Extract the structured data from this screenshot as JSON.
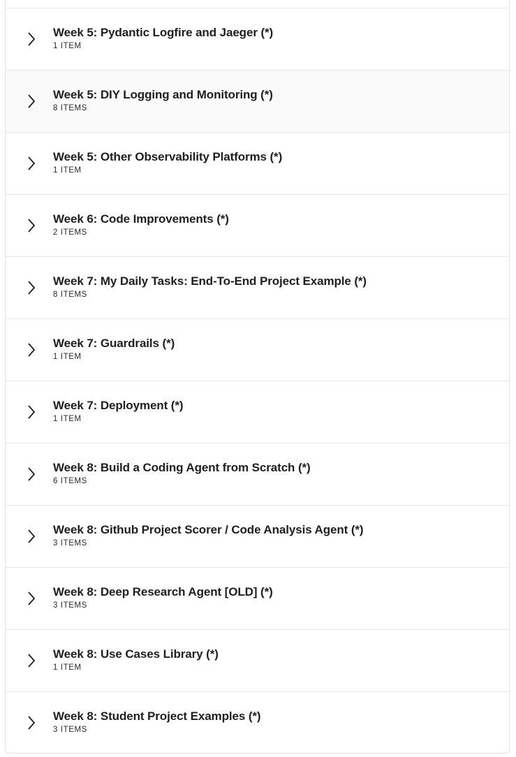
{
  "sections": [
    {
      "title": "Week 5: Pydantic Logfire and Jaeger (*)",
      "count": "1 ITEM",
      "icon": "chevron-right-icon"
    },
    {
      "title": "Week 5: DIY Logging and Monitoring (*)",
      "count": "8 ITEMS",
      "icon": "chevron-right-icon"
    },
    {
      "title": "Week 5: Other Observability Platforms (*)",
      "count": "1 ITEM",
      "icon": "chevron-right-icon"
    },
    {
      "title": "Week 6: Code Improvements (*)",
      "count": "2 ITEMS",
      "icon": "chevron-right-icon"
    },
    {
      "title": "Week 7: My Daily Tasks: End-To-End Project Example (*)",
      "count": "8 ITEMS",
      "icon": "chevron-right-icon"
    },
    {
      "title": "Week 7: Guardrails (*)",
      "count": "1 ITEM",
      "icon": "chevron-right-icon"
    },
    {
      "title": "Week 7: Deployment (*)",
      "count": "1 ITEM",
      "icon": "chevron-right-icon"
    },
    {
      "title": "Week 8: Build a Coding Agent from Scratch (*)",
      "count": "6 ITEMS",
      "icon": "chevron-right-icon"
    },
    {
      "title": "Week 8: Github Project Scorer / Code Analysis Agent (*)",
      "count": "3 ITEMS",
      "icon": "chevron-right-icon"
    },
    {
      "title": "Week 8: Deep Research Agent [OLD] (*)",
      "count": "3 ITEMS",
      "icon": "chevron-right-icon"
    },
    {
      "title": "Week 8: Use Cases Library (*)",
      "count": "1 ITEM",
      "icon": "chevron-right-icon"
    },
    {
      "title": "Week 8: Student Project Examples (*)",
      "count": "3 ITEMS",
      "icon": "chevron-right-icon"
    }
  ],
  "colors": {
    "hover_row": "#fafafa",
    "border": "#e6e6e6",
    "text": "#1f1f1f"
  }
}
